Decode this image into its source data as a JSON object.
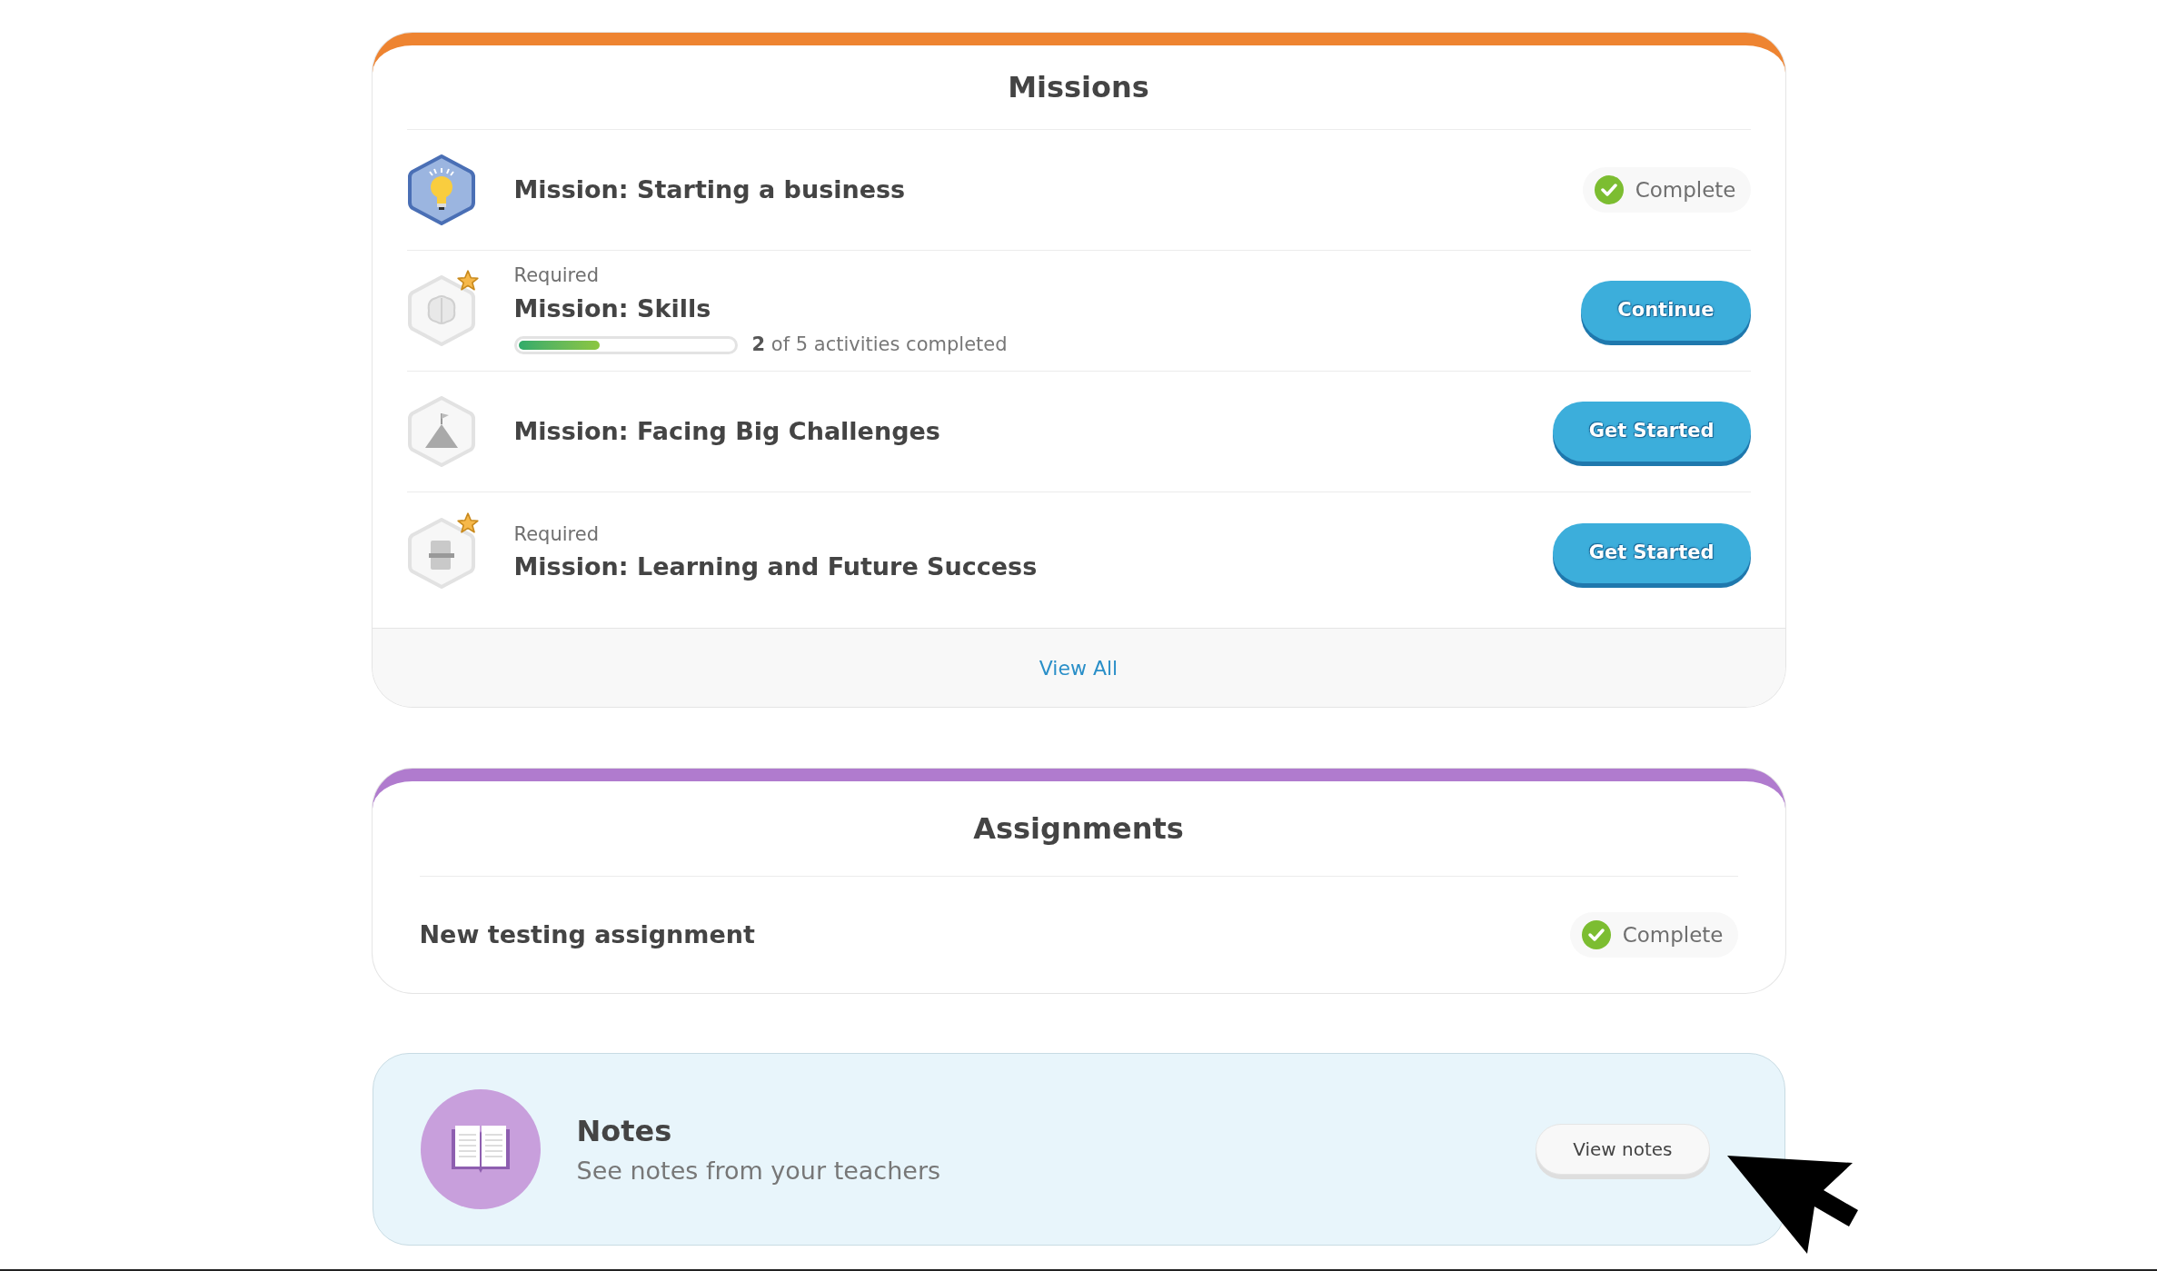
{
  "missions": {
    "title": "Missions",
    "items": [
      {
        "active": true,
        "starred": false,
        "title": "Mission: Starting a business",
        "status": {
          "kind": "badge",
          "label": "Complete"
        }
      },
      {
        "active": false,
        "starred": true,
        "required": "Required",
        "title": "Mission: Skills",
        "progress": {
          "level": 0.38,
          "count": "2",
          "text": "of 5 activities completed"
        },
        "status": {
          "kind": "button",
          "label": "Continue"
        }
      },
      {
        "active": false,
        "starred": false,
        "title": "Mission: Facing Big Challenges",
        "status": {
          "kind": "button",
          "label": "Get Started"
        }
      },
      {
        "active": false,
        "starred": true,
        "required": "Required",
        "title": "Mission: Learning and Future Success",
        "status": {
          "kind": "button",
          "label": "Get Started"
        }
      }
    ],
    "footer_link": "View All"
  },
  "assignments": {
    "title": "Assignments",
    "items": [
      {
        "title": "New testing assignment",
        "status": {
          "kind": "badge",
          "label": "Complete"
        }
      }
    ]
  },
  "notes": {
    "title": "Notes",
    "subtitle": "See notes from your teachers",
    "button": "View notes"
  }
}
